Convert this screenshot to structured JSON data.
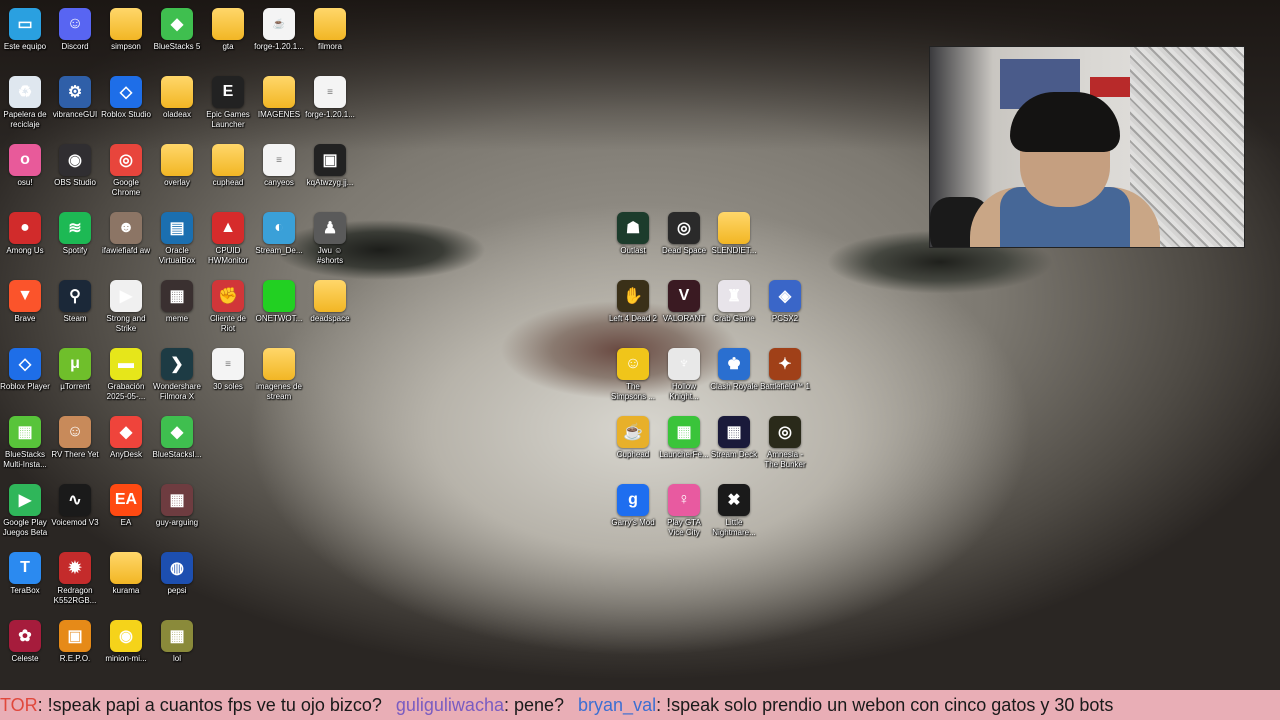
{
  "desktop_icons": [
    {
      "label": "Este equipo",
      "icon": "monitor-icon",
      "color": "#2aa0e0",
      "kind": "app",
      "glyph": "▭"
    },
    {
      "label": "Discord",
      "icon": "discord-icon",
      "color": "#5865f2",
      "kind": "app",
      "glyph": "☺"
    },
    {
      "label": "simpson",
      "icon": "folder-icon",
      "color": "#f2b624",
      "kind": "folder",
      "glyph": ""
    },
    {
      "label": "BlueStacks 5",
      "icon": "bluestacks-icon",
      "color": "#3fbf4f",
      "kind": "app",
      "glyph": "◆"
    },
    {
      "label": "gta",
      "icon": "folder-icon",
      "color": "#f2b624",
      "kind": "folder",
      "glyph": ""
    },
    {
      "label": "forge-1.20.1...",
      "icon": "java-icon",
      "color": "#e04b2a",
      "kind": "file",
      "glyph": "☕"
    },
    {
      "label": "filmora",
      "icon": "folder-icon",
      "color": "#f2b624",
      "kind": "folder",
      "glyph": ""
    },
    {
      "label": "Papelera de reciclaje",
      "icon": "recycle-bin-icon",
      "color": "#dfe7ef",
      "kind": "app",
      "glyph": "♻"
    },
    {
      "label": "vibranceGUI",
      "icon": "gear-icon",
      "color": "#2f5fa8",
      "kind": "app",
      "glyph": "⚙"
    },
    {
      "label": "Roblox Studio",
      "icon": "roblox-studio-icon",
      "color": "#1e6ee8",
      "kind": "app",
      "glyph": "◇"
    },
    {
      "label": "oladeax",
      "icon": "folder-icon",
      "color": "#f2b624",
      "kind": "folder",
      "glyph": ""
    },
    {
      "label": "Epic Games Launcher",
      "icon": "epic-games-icon",
      "color": "#222222",
      "kind": "app",
      "glyph": "E"
    },
    {
      "label": "IMAGENES",
      "icon": "folder-icon",
      "color": "#f2b624",
      "kind": "folder",
      "glyph": ""
    },
    {
      "label": "forge-1.20.1...",
      "icon": "document-icon",
      "color": "#f4f4f4",
      "kind": "file",
      "glyph": "≡"
    },
    {
      "label": "osu!",
      "icon": "osu-icon",
      "color": "#e85a9a",
      "kind": "app",
      "glyph": "o"
    },
    {
      "label": "OBS Studio",
      "icon": "obs-icon",
      "color": "#302e31",
      "kind": "app",
      "glyph": "◉"
    },
    {
      "label": "Google Chrome",
      "icon": "chrome-icon",
      "color": "#e8453c",
      "kind": "app",
      "glyph": "◎"
    },
    {
      "label": "overlay",
      "icon": "folder-icon",
      "color": "#f2b624",
      "kind": "folder",
      "glyph": ""
    },
    {
      "label": "cuphead",
      "icon": "folder-icon",
      "color": "#f2b624",
      "kind": "folder",
      "glyph": ""
    },
    {
      "label": "canyeos",
      "icon": "document-icon",
      "color": "#f4f4f4",
      "kind": "file",
      "glyph": "≡"
    },
    {
      "label": "kqAtwzyg.jj...",
      "icon": "image-file-icon",
      "color": "#222222",
      "kind": "app",
      "glyph": "▣"
    },
    {
      "label": "Among Us",
      "icon": "among-us-icon",
      "color": "#d12b2b",
      "kind": "app",
      "glyph": "●"
    },
    {
      "label": "Spotify",
      "icon": "spotify-icon",
      "color": "#1db954",
      "kind": "app",
      "glyph": "≋"
    },
    {
      "label": "ifawiefiafd aw",
      "icon": "image-file-icon",
      "color": "#8c7565",
      "kind": "app",
      "glyph": "☻"
    },
    {
      "label": "Oracle VirtualBox",
      "icon": "virtualbox-icon",
      "color": "#1b6fb0",
      "kind": "app",
      "glyph": "▤"
    },
    {
      "label": "CPUID HWMonitor",
      "icon": "hwmonitor-icon",
      "color": "#d62b2b",
      "kind": "app",
      "glyph": "▲"
    },
    {
      "label": "Stream_De...",
      "icon": "stream-deck-file-icon",
      "color": "#3aa0d8",
      "kind": "app",
      "glyph": "◐"
    },
    {
      "label": "Jwu ☺ #shorts",
      "icon": "video-file-icon",
      "color": "#5a5a5a",
      "kind": "app",
      "glyph": "♟"
    },
    {
      "label": "Brave",
      "icon": "brave-icon",
      "color": "#fb542b",
      "kind": "app",
      "glyph": "▼"
    },
    {
      "label": "Steam",
      "icon": "steam-icon",
      "color": "#1b2838",
      "kind": "app",
      "glyph": "⚲"
    },
    {
      "label": "Strong and Strike",
      "icon": "video-file-icon",
      "color": "#f0f0f0",
      "kind": "app",
      "glyph": "▶"
    },
    {
      "label": "meme",
      "icon": "video-file-icon",
      "color": "#3a3030",
      "kind": "app",
      "glyph": "▦"
    },
    {
      "label": "Cliente de Riot",
      "icon": "riot-icon",
      "color": "#d13639",
      "kind": "app",
      "glyph": "✊"
    },
    {
      "label": "ONETWOT...",
      "icon": "green-file-icon",
      "color": "#22d022",
      "kind": "app",
      "glyph": ""
    },
    {
      "label": "deadspace",
      "icon": "folder-icon",
      "color": "#f2b624",
      "kind": "folder",
      "glyph": ""
    },
    {
      "label": "Roblox Player",
      "icon": "roblox-icon",
      "color": "#1e6ee8",
      "kind": "app",
      "glyph": "◇"
    },
    {
      "label": "µTorrent",
      "icon": "utorrent-icon",
      "color": "#6fbf2b",
      "kind": "app",
      "glyph": "μ"
    },
    {
      "label": "Grabación 2025-05-...",
      "icon": "recording-file-icon",
      "color": "#e6e61a",
      "kind": "app",
      "glyph": "▬"
    },
    {
      "label": "Wondershare Filmora X",
      "icon": "filmora-icon",
      "color": "#1d3b44",
      "kind": "app",
      "glyph": "❯"
    },
    {
      "label": "30 soles",
      "icon": "document-icon",
      "color": "#f4f4f4",
      "kind": "file",
      "glyph": "≡"
    },
    {
      "label": "imagenes de stream",
      "icon": "folder-icon",
      "color": "#f2b624",
      "kind": "folder",
      "glyph": ""
    },
    {
      "label": "BlueStacks Multi-Insta...",
      "icon": "bluestacks-multi-icon",
      "color": "#58c43a",
      "kind": "app",
      "glyph": "▦"
    },
    {
      "label": "RV There Yet",
      "icon": "rv-there-yet-icon",
      "color": "#c88a5a",
      "kind": "app",
      "glyph": "☺"
    },
    {
      "label": "AnyDesk",
      "icon": "anydesk-icon",
      "color": "#ef443b",
      "kind": "app",
      "glyph": "◆"
    },
    {
      "label": "BlueStacksI...",
      "icon": "bluestacks-icon",
      "color": "#3fbf4f",
      "kind": "app",
      "glyph": "◆"
    },
    {
      "label": "Google Play Juegos Beta",
      "icon": "google-play-games-icon",
      "color": "#2fb65a",
      "kind": "app",
      "glyph": "▶"
    },
    {
      "label": "Voicemod V3",
      "icon": "voicemod-icon",
      "color": "#1a1a1a",
      "kind": "app",
      "glyph": "∿"
    },
    {
      "label": "EA",
      "icon": "ea-icon",
      "color": "#ff4a12",
      "kind": "app",
      "glyph": "EA"
    },
    {
      "label": "guy-arguing",
      "icon": "video-file-icon",
      "color": "#6e3c40",
      "kind": "app",
      "glyph": "▦"
    },
    {
      "label": "TeraBox",
      "icon": "terabox-icon",
      "color": "#2b8af0",
      "kind": "app",
      "glyph": "T"
    },
    {
      "label": "Redragon K552RGB...",
      "icon": "redragon-icon",
      "color": "#c42b2b",
      "kind": "app",
      "glyph": "✹"
    },
    {
      "label": "kurama",
      "icon": "folder-icon",
      "color": "#f2b624",
      "kind": "folder",
      "glyph": ""
    },
    {
      "label": "pepsi",
      "icon": "pepsi-icon",
      "color": "#1d4fb0",
      "kind": "app",
      "glyph": "◍"
    },
    {
      "label": "Celeste",
      "icon": "celeste-icon",
      "color": "#a61c3c",
      "kind": "app",
      "glyph": "✿"
    },
    {
      "label": "R.E.P.O.",
      "icon": "repo-icon",
      "color": "#e68a18",
      "kind": "app",
      "glyph": "▣"
    },
    {
      "label": "minion-mi...",
      "icon": "minion-icon",
      "color": "#f5d31a",
      "kind": "app",
      "glyph": "◉"
    },
    {
      "label": "lol",
      "icon": "video-file-icon",
      "color": "#8a8a3a",
      "kind": "app",
      "glyph": "▦"
    }
  ],
  "center_icons": [
    {
      "label": "Outlast",
      "icon": "outlast-icon",
      "color": "#1c3c2c",
      "kind": "app",
      "glyph": "☗"
    },
    {
      "label": "Dead Space",
      "icon": "dead-space-icon",
      "color": "#2a2a2a",
      "kind": "app",
      "glyph": "◎"
    },
    {
      "label": "SLENDIET...",
      "icon": "folder-icon",
      "color": "#f2b624",
      "kind": "folder",
      "glyph": ""
    },
    {
      "label": "Left 4 Dead 2",
      "icon": "left4dead-icon",
      "color": "#3a3018",
      "kind": "app",
      "glyph": "✋"
    },
    {
      "label": "VALORANT",
      "icon": "valorant-icon",
      "color": "#3a1a22",
      "kind": "app",
      "glyph": "V"
    },
    {
      "label": "Crab Game",
      "icon": "crab-game-icon",
      "color": "#e8e4ea",
      "kind": "app",
      "glyph": "♜"
    },
    {
      "label": "PCSX2",
      "icon": "pcsx2-icon",
      "color": "#3a66c8",
      "kind": "app",
      "glyph": "◈"
    },
    {
      "label": "The Simpsons ...",
      "icon": "simpsons-icon",
      "color": "#f0c51a",
      "kind": "app",
      "glyph": "☺"
    },
    {
      "label": "Hollow Knight...",
      "icon": "hollow-knight-icon",
      "color": "#e8e8e8",
      "kind": "app",
      "glyph": "♆"
    },
    {
      "label": "Clash Royale",
      "icon": "clash-royale-icon",
      "color": "#2a6fd0",
      "kind": "app",
      "glyph": "♚"
    },
    {
      "label": "Battlefield™ 1",
      "icon": "battlefield-icon",
      "color": "#a04018",
      "kind": "app",
      "glyph": "✦"
    },
    {
      "label": "Cuphead",
      "icon": "cuphead-icon",
      "color": "#e8b02a",
      "kind": "app",
      "glyph": "☕"
    },
    {
      "label": "LauncherFe...",
      "icon": "minecraft-creeper-icon",
      "color": "#3ac43a",
      "kind": "app",
      "glyph": "▦"
    },
    {
      "label": "Stream Deck",
      "icon": "stream-deck-icon",
      "color": "#1a1a3a",
      "kind": "app",
      "glyph": "▦"
    },
    {
      "label": "Amnesia - The Bunker",
      "icon": "amnesia-icon",
      "color": "#2a2a1a",
      "kind": "app",
      "glyph": "◎"
    },
    {
      "label": "Garry's Mod",
      "icon": "garrys-mod-icon",
      "color": "#1e6ef0",
      "kind": "app",
      "glyph": "g"
    },
    {
      "label": "Play GTA Vice City",
      "icon": "gta-vice-city-icon",
      "color": "#e85aa0",
      "kind": "app",
      "glyph": "♀"
    },
    {
      "label": "Little Nightmare...",
      "icon": "little-nightmares-icon",
      "color": "#1a1a1a",
      "kind": "app",
      "glyph": "✖"
    }
  ],
  "webcam": {
    "label": "webcam-overlay"
  },
  "chat": [
    {
      "user": "TOR",
      "msg": ": !speak papi a cuantos fps ve tu ojo bizco?"
    },
    {
      "user": "guliguliwacha",
      "msg": ": pene?"
    },
    {
      "user": "bryan_val",
      "msg": ": !speak solo prendio un webon con cinco gatos y 30 bots"
    }
  ]
}
